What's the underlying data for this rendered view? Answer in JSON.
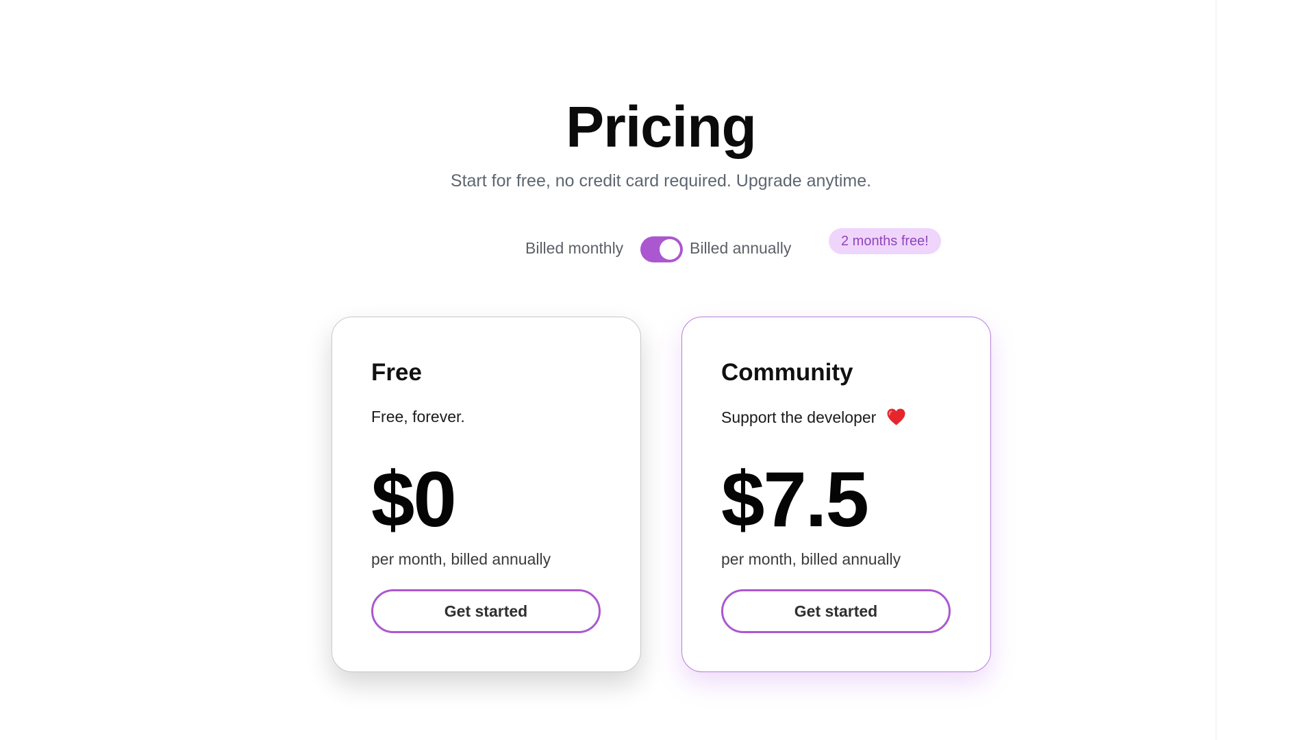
{
  "header": {
    "title": "Pricing",
    "subtitle": "Start for free, no credit card required. Upgrade anytime."
  },
  "billing": {
    "monthly_label": "Billed monthly",
    "annually_label": "Billed annually",
    "toggle_state": "annually",
    "badge": "2 months free!"
  },
  "plans": [
    {
      "name": "Free",
      "description": "Free, forever.",
      "price": "$0",
      "period": "per month, billed annually",
      "cta": "Get started"
    },
    {
      "name": "Community",
      "description": "Support the developer",
      "description_icon": "heart-icon",
      "price": "$7.5",
      "period": "per month, billed annually",
      "cta": "Get started"
    }
  ],
  "colors": {
    "accent": "#ab57cf",
    "badge_background": "#efd5fb",
    "badge_text": "#8f45bb",
    "heart": "#e5272d"
  }
}
